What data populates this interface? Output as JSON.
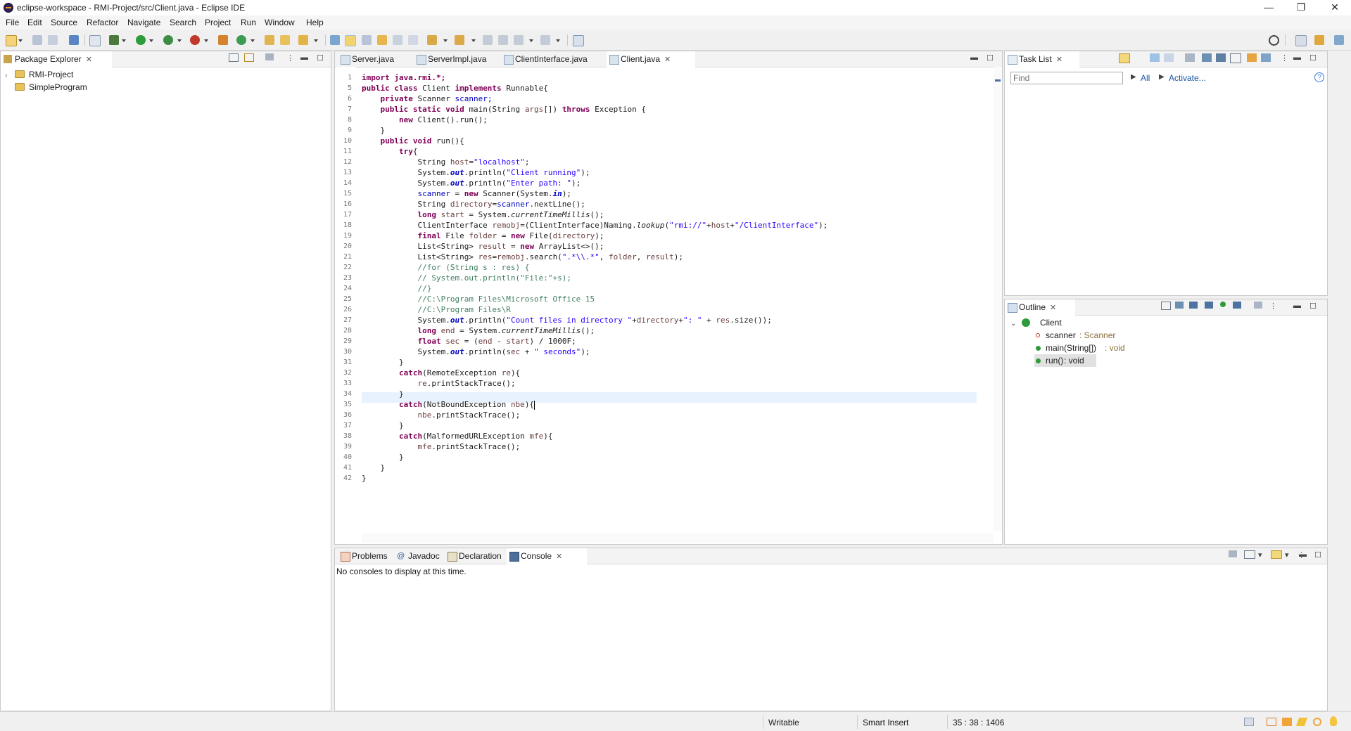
{
  "window": {
    "title": "eclipse-workspace - RMI-Project/src/Client.java - Eclipse IDE",
    "minimize": "—",
    "restore": "❐",
    "close": "✕"
  },
  "menu": [
    "File",
    "Edit",
    "Source",
    "Refactor",
    "Navigate",
    "Search",
    "Project",
    "Run",
    "Window",
    "Help"
  ],
  "package_explorer": {
    "tab": "Package Explorer",
    "projects": [
      "RMI-Project",
      "SimpleProgram"
    ]
  },
  "editor": {
    "tabs": [
      "Server.java",
      "ServerImpl.java",
      "ClientInterface.java",
      "Client.java"
    ],
    "active_tab": "Client.java",
    "line_numbers": [
      "1",
      "5",
      "6",
      "7",
      "8",
      "9",
      "10",
      "11",
      "12",
      "13",
      "14",
      "15",
      "16",
      "17",
      "18",
      "19",
      "20",
      "21",
      "22",
      "23",
      "24",
      "25",
      "26",
      "27",
      "28",
      "29",
      "30",
      "31",
      "32",
      "33",
      "34",
      "35",
      "36",
      "37",
      "38",
      "39",
      "40",
      "41",
      "42"
    ],
    "code": {
      "l1": "import java.rmi.*;",
      "l5a": "public class ",
      "l5b": "Client ",
      "l5c": "implements ",
      "l5d": "Runnable{",
      "l6a": "    private ",
      "l6b": "Scanner ",
      "l6c": "scanner;",
      "l7a": "    public static void ",
      "l7b": "main(String ",
      "l7c": "args",
      "l7d": "[]) ",
      "l7e": "throws ",
      "l7f": "Exception {",
      "l8a": "        new ",
      "l8b": "Client().run();",
      "l9": "    }",
      "l10a": "    public void ",
      "l10b": "run(){",
      "l11a": "        try",
      "l11b": "{",
      "l12a": "            String ",
      "l12b": "host",
      "l12c": "=",
      "l12d": "\"localhost\"",
      "l12e": ";",
      "l13a": "            System.",
      "l13b": "out",
      "l13c": ".println(",
      "l13d": "\"Client running\"",
      "l13e": ");",
      "l14a": "            System.",
      "l14b": "out",
      "l14c": ".println(",
      "l14d": "\"Enter path: \"",
      "l14e": ");",
      "l15a": "            ",
      "l15b": "scanner",
      "l15c": " = ",
      "l15d": "new ",
      "l15e": "Scanner(System.",
      "l15f": "in",
      "l15g": ");",
      "l16a": "            String ",
      "l16b": "directory",
      "l16c": "=",
      "l16d": "scanner",
      "l16e": ".nextLine();",
      "l17a": "            long ",
      "l17b": "start",
      "l17c": " = System.",
      "l17d": "currentTimeMillis",
      "l17e": "();",
      "l18a": "            ClientInterface ",
      "l18b": "remobj",
      "l18c": "=(ClientInterface)Naming.",
      "l18d": "lookup",
      "l18e": "(",
      "l18f": "\"rmi://\"",
      "l18g": "+",
      "l18h": "host",
      "l18i": "+",
      "l18j": "\"/ClientInterface\"",
      "l18k": ");",
      "l19a": "            final ",
      "l19b": "File ",
      "l19c": "folder",
      "l19d": " = ",
      "l19e": "new ",
      "l19f": "File(",
      "l19g": "directory",
      "l19h": ");",
      "l20a": "            List<String> ",
      "l20b": "result",
      "l20c": " = ",
      "l20d": "new ",
      "l20e": "ArrayList<>();",
      "l21a": "            List<String> ",
      "l21b": "res",
      "l21c": "=",
      "l21d": "remobj",
      "l21e": ".search(",
      "l21f": "\".*\\\\.*\"",
      "l21g": ", ",
      "l21h": "folder",
      "l21i": ", ",
      "l21j": "result",
      "l21k": ");",
      "l22": "            //for (String s : res) {",
      "l23": "            // System.out.println(\"File:\"+s);",
      "l24": "            //}",
      "l25": "            //C:\\Program Files\\Microsoft Office 15",
      "l26": "            //C:\\Program Files\\R",
      "l27a": "            System.",
      "l27b": "out",
      "l27c": ".println(",
      "l27d": "\"Count files in directory \"",
      "l27e": "+",
      "l27f": "directory",
      "l27g": "+",
      "l27h": "\": \"",
      "l27i": " + ",
      "l27j": "res",
      "l27k": ".size());",
      "l28a": "            long ",
      "l28b": "end",
      "l28c": " = System.",
      "l28d": "currentTimeMillis",
      "l28e": "();",
      "l29a": "            float ",
      "l29b": "sec",
      "l29c": " = (",
      "l29d": "end",
      "l29e": " - ",
      "l29f": "start",
      "l29g": ") / 1000F;",
      "l30a": "            System.",
      "l30b": "out",
      "l30c": ".println(",
      "l30d": "sec",
      "l30e": " + ",
      "l30f": "\" seconds\"",
      "l30g": ");",
      "l31": "        }",
      "l32a": "        catch",
      "l32b": "(RemoteException ",
      "l32c": "re",
      "l32d": "){",
      "l33a": "            ",
      "l33b": "re",
      "l33c": ".printStackTrace();",
      "l34": "        }",
      "l35a": "        catch",
      "l35b": "(NotBoundException ",
      "l35c": "nbe",
      "l35d": "){",
      "l36a": "            ",
      "l36b": "nbe",
      "l36c": ".printStackTrace();",
      "l37": "        }",
      "l38a": "        catch",
      "l38b": "(MalformedURLException ",
      "l38c": "mfe",
      "l38d": "){",
      "l39a": "            ",
      "l39b": "mfe",
      "l39c": ".printStackTrace();",
      "l40": "        }",
      "l41": "    }",
      "l42": "}"
    }
  },
  "task_list": {
    "tab": "Task List",
    "find_placeholder": "Find",
    "all": "All",
    "activate": "Activate..."
  },
  "outline": {
    "tab": "Outline",
    "class": "Client",
    "members": [
      {
        "name": "scanner",
        "type": " : Scanner"
      },
      {
        "name": "main(String[])",
        "type": " : void"
      },
      {
        "name": "run()",
        "type": " : void"
      }
    ]
  },
  "bottom": {
    "tabs": [
      "Problems",
      "Javadoc",
      "Declaration",
      "Console"
    ],
    "message": "No consoles to display at this time."
  },
  "status": {
    "writable": "Writable",
    "insert_mode": "Smart Insert",
    "position": "35 : 38 : 1406"
  },
  "colors": {
    "keyword": "#7f0055",
    "string": "#2a00ff",
    "comment": "#3f7f5f",
    "field": "#0000c0"
  }
}
